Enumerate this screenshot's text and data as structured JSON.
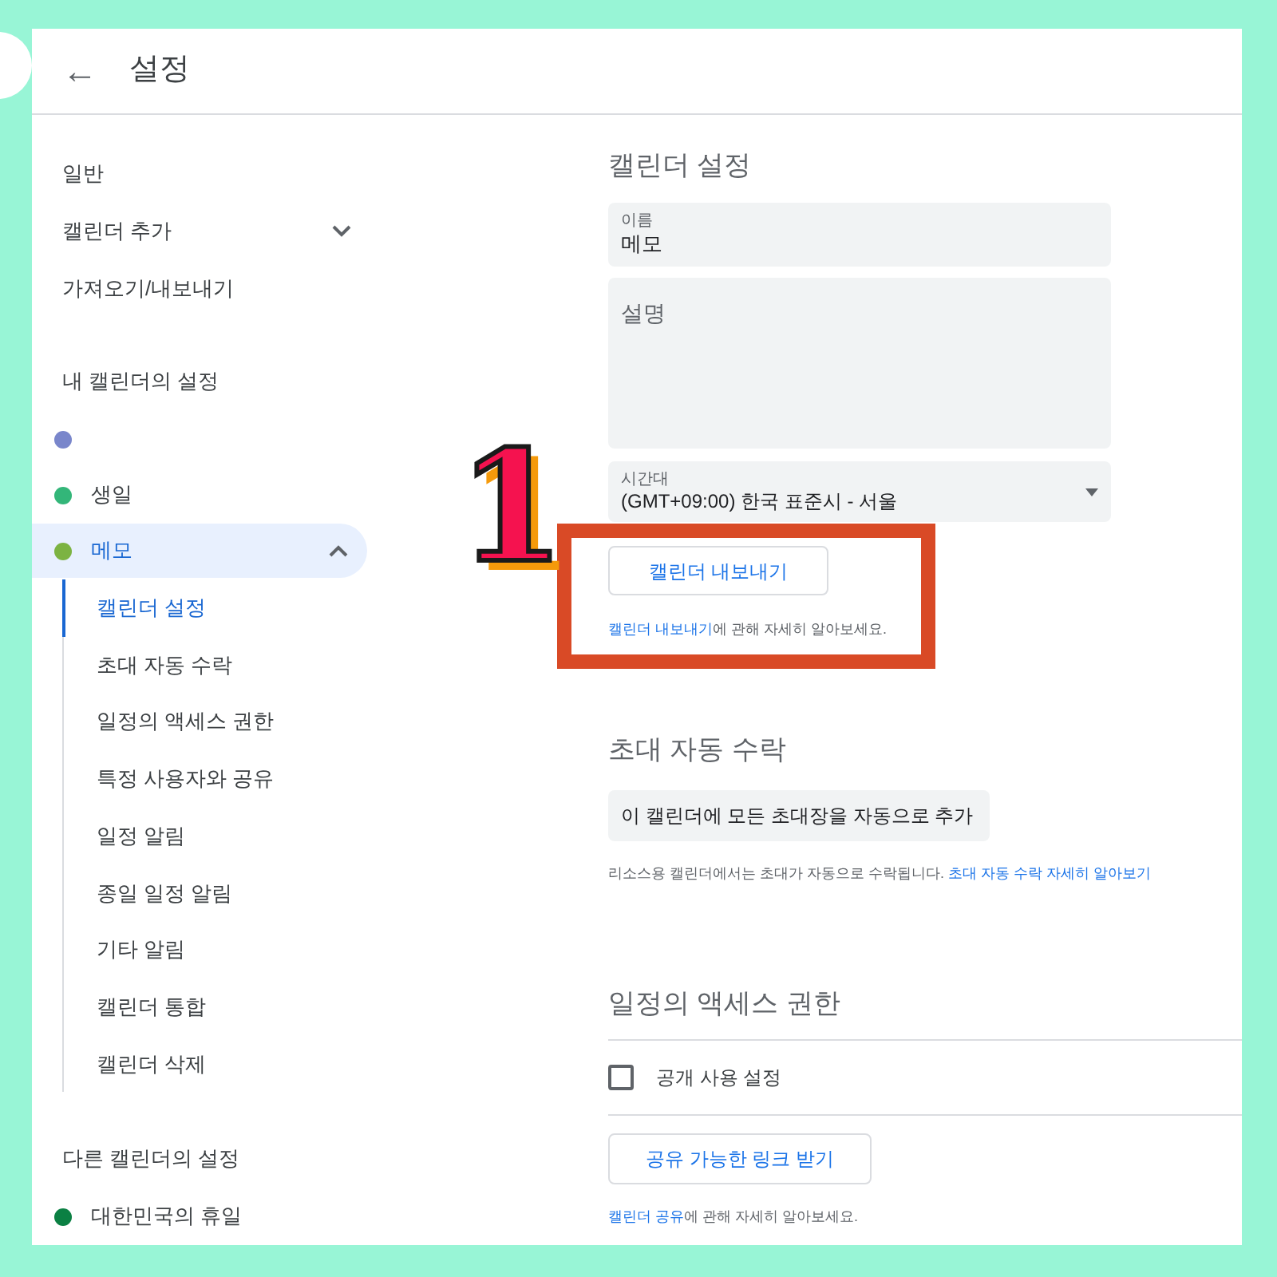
{
  "header": {
    "back": "←",
    "title": "설정"
  },
  "sidebar": {
    "general": [
      {
        "label": "일반",
        "expandable": false
      },
      {
        "label": "캘린더 추가",
        "expandable": true
      },
      {
        "label": "가져오기/내보내기",
        "expandable": false
      }
    ],
    "my_calendars_heading": "내 캘린더의 설정",
    "my_calendars": [
      {
        "color": "#7986cb",
        "expanded": false
      },
      {
        "name": "생일",
        "color": "#33b679",
        "expanded": false
      },
      {
        "name": "메모",
        "color": "#7cb342",
        "expanded": true,
        "children": [
          {
            "label": "캘린더 설정",
            "selected": true
          },
          {
            "label": "초대 자동 수락",
            "selected": false
          },
          {
            "label": "일정의 액세스 권한",
            "selected": false
          },
          {
            "label": "특정 사용자와 공유",
            "selected": false
          },
          {
            "label": "일정 알림",
            "selected": false
          },
          {
            "label": "종일 일정 알림",
            "selected": false
          },
          {
            "label": "기타 알림",
            "selected": false
          },
          {
            "label": "캘린더 통합",
            "selected": false
          },
          {
            "label": "캘린더 삭제",
            "selected": false
          }
        ]
      }
    ],
    "other_calendars_heading": "다른 캘린더의 설정",
    "other_calendars": [
      {
        "name": "대한민국의 휴일",
        "color": "#0b8043"
      }
    ]
  },
  "calendar_settings": {
    "heading": "캘린더 설정",
    "name_field": {
      "label": "이름",
      "value": "메모"
    },
    "description_field": {
      "placeholder": "설명"
    },
    "timezone": {
      "label": "시간대",
      "value": "(GMT+09:00) 한국 표준시 - 서울"
    },
    "export_button": "캘린더 내보내기",
    "help": {
      "link": "캘린더 내보내기",
      "text": "에 관해 자세히 알아보세요."
    }
  },
  "auto_accept": {
    "heading": "초대 자동 수락",
    "dropdown": "이 캘린더에 모든 초대장을 자동으로 추가",
    "help": {
      "text": "리소스용 캘린더에서는 초대가 자동으로 수락됩니다.",
      "link": "초대 자동 수락 자세히 알아보기"
    }
  },
  "access": {
    "heading": "일정의 액세스 권한",
    "public": {
      "label": "공개 사용 설정",
      "checked": false
    },
    "link_button": "공유 가능한 링크 받기",
    "help": {
      "link": "캘린더 공유",
      "text": "에 관해 자세히 알아보세요."
    }
  },
  "annotation": {
    "number": "1"
  }
}
